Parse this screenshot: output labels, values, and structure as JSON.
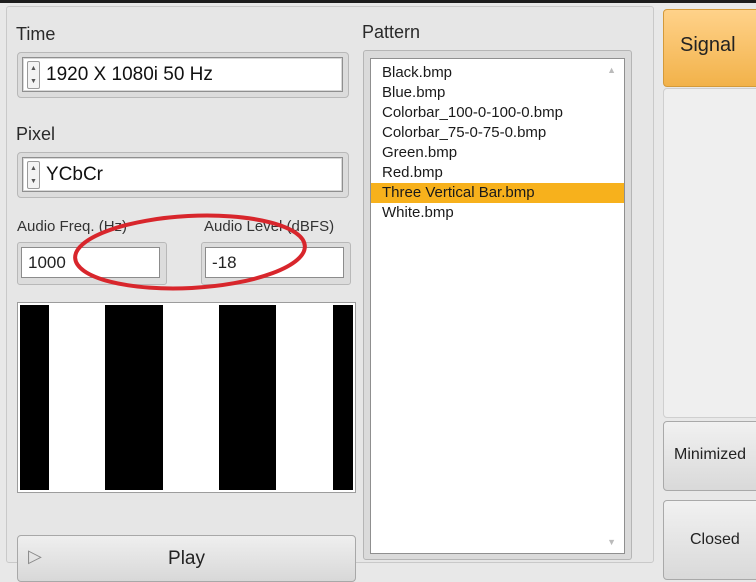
{
  "labels": {
    "time": "Time",
    "pixel": "Pixel",
    "audio_freq": "Audio Freq. (Hz)",
    "audio_level": "Audio Level  (dBFS)",
    "pattern": "Pattern"
  },
  "fields": {
    "time_value": "1920 X 1080i 50 Hz",
    "pixel_value": "YCbCr",
    "audio_freq_value": "1000",
    "audio_level_value": "-18"
  },
  "pattern_list": {
    "items": [
      "Black.bmp",
      "Blue.bmp",
      "Colorbar_100-0-100-0.bmp",
      "Colorbar_75-0-75-0.bmp",
      "Green.bmp",
      "Red.bmp",
      "Three Vertical Bar.bmp",
      "White.bmp"
    ],
    "selected": "Three Vertical Bar.bmp"
  },
  "buttons": {
    "play": "Play",
    "signal": "Signal",
    "minimized": "Minimized",
    "closed": "Closed"
  },
  "icons": {
    "spinner": "spinner-icon",
    "play": "play-triangle-icon",
    "scroll_up": "scroll-up-icon",
    "scroll_down": "scroll-down-icon"
  },
  "colors": {
    "selection": "#f7b11c",
    "signal_button": "#f2b24a",
    "annotation": "#d8262c"
  }
}
